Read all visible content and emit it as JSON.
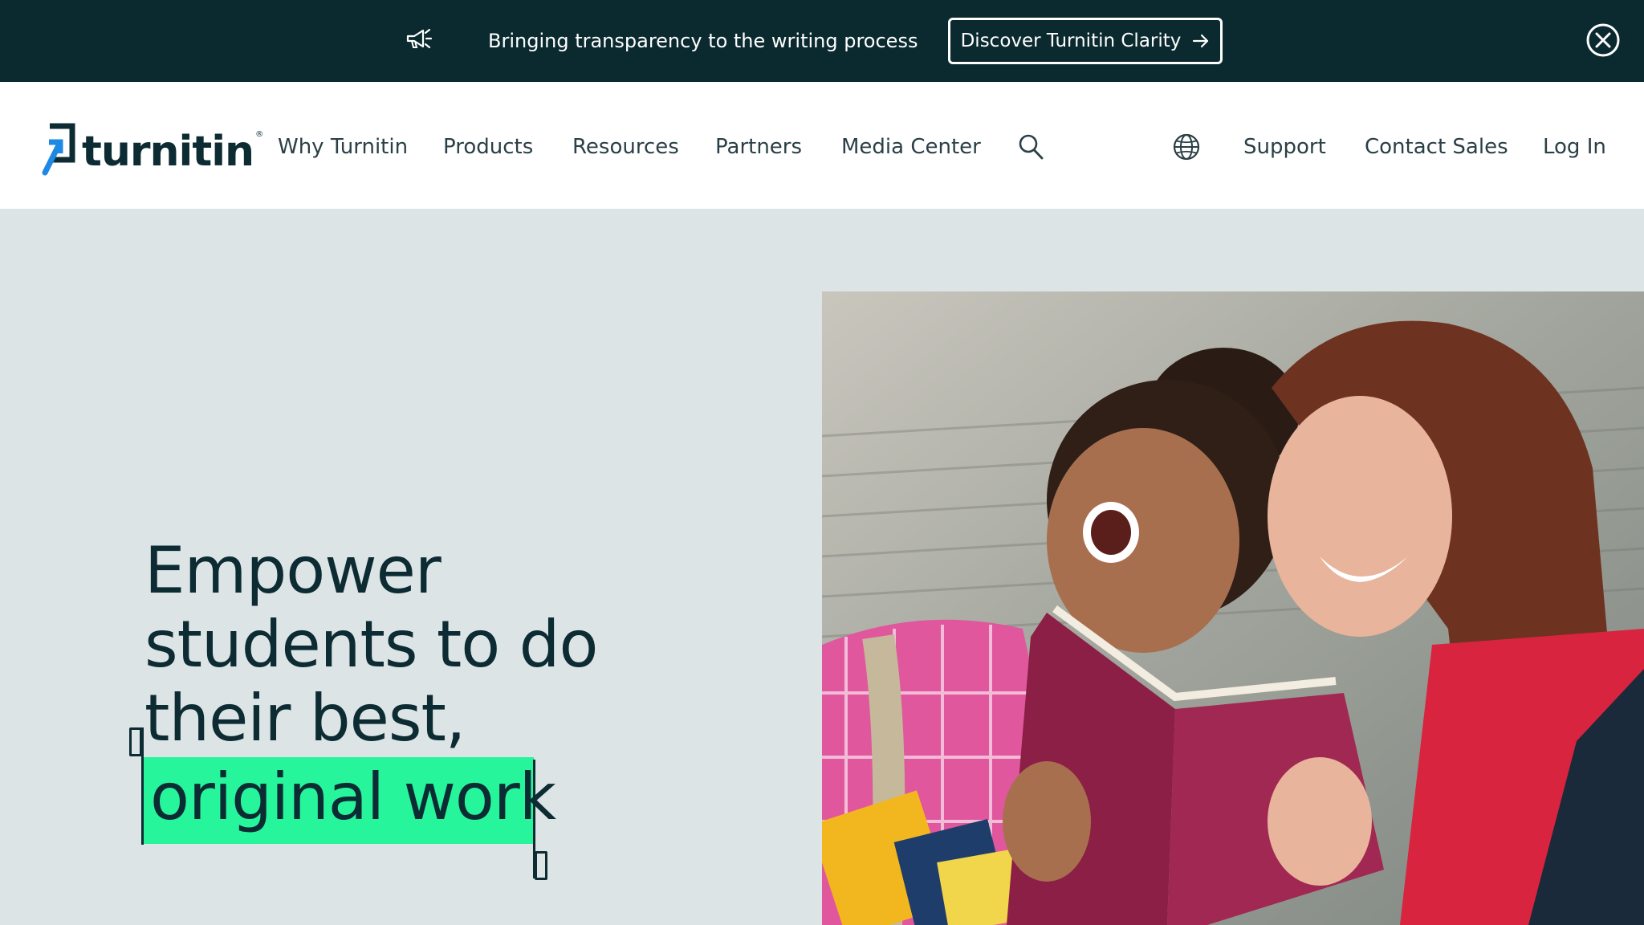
{
  "announcement": {
    "message": "Bringing transparency to the writing process",
    "cta_label": "Discover Turnitin Clarity",
    "icon": "megaphone-icon",
    "close_icon": "close-circle-icon"
  },
  "header": {
    "logo_text": "turnitin",
    "logo_mark": "®",
    "nav_left": [
      "Why Turnitin",
      "Products",
      "Resources",
      "Partners",
      "Media Center"
    ],
    "nav_right": [
      "Support",
      "Contact Sales",
      "Log In"
    ],
    "search_icon": "search-icon",
    "language_icon": "globe-icon"
  },
  "hero": {
    "headline_lines": [
      "Empower",
      "students to do",
      "their best,"
    ],
    "highlight": "original work",
    "image": "two students laughing reading a red book"
  },
  "colors": {
    "topbar_bg": "#0b2a30",
    "hero_bg": "#dde4e5",
    "highlight": "#26f59c",
    "text_dark": "#0c2b33",
    "logo_blue": "#1e88e5"
  }
}
